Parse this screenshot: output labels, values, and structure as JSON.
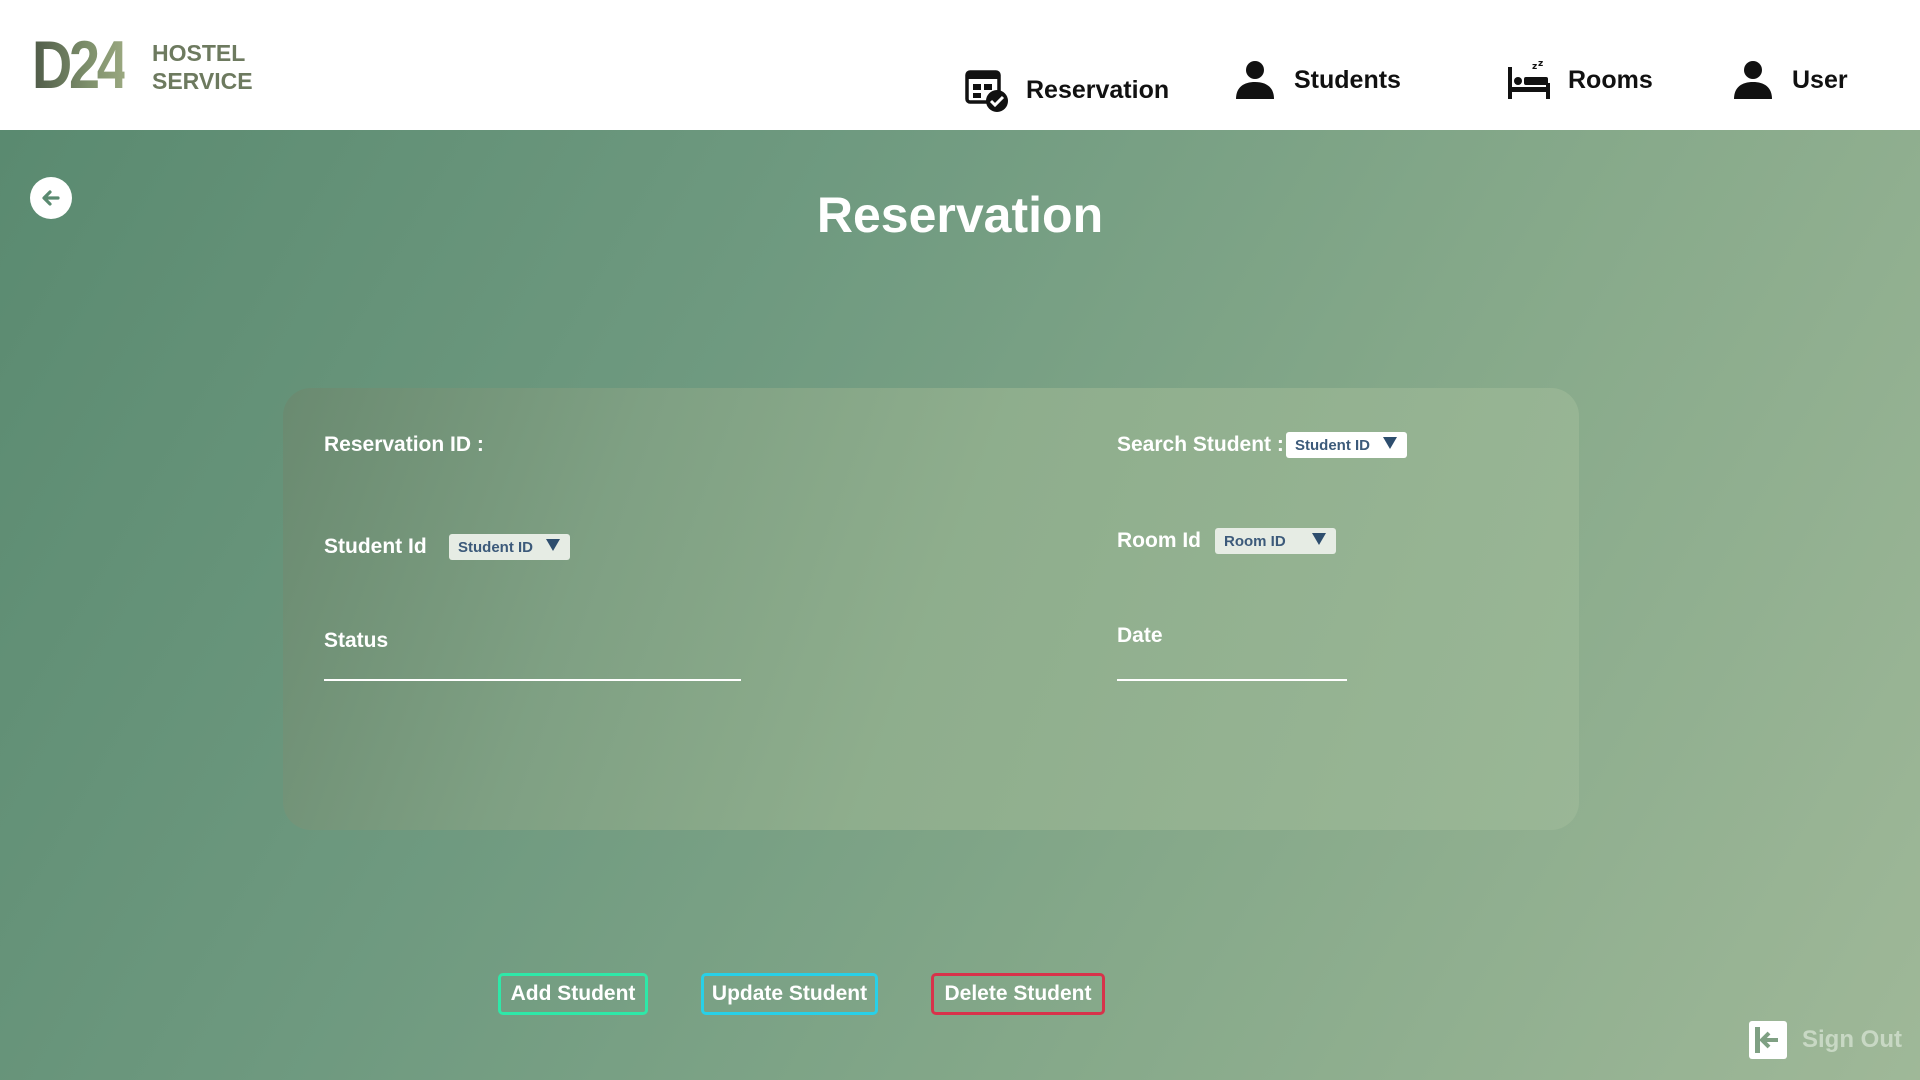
{
  "brand": {
    "mark": "D24",
    "line1": "HOSTEL",
    "line2": "SERVICE"
  },
  "nav": {
    "reservation": {
      "label": "Reservation",
      "icon": "calendar-check-icon"
    },
    "students": {
      "label": "Students",
      "icon": "person-icon"
    },
    "rooms": {
      "label": "Rooms",
      "icon": "bed-icon"
    },
    "user": {
      "label": "User",
      "icon": "person-icon"
    }
  },
  "page": {
    "title": "Reservation",
    "back_icon": "arrow-left-icon"
  },
  "form": {
    "reservation_id_label": "Reservation ID :",
    "search_student_label": "Search Student :",
    "search_student_select": "Student ID",
    "student_id_label": "Student Id",
    "student_id_select": "Student ID",
    "room_id_label": "Room Id",
    "room_id_select": "Room ID",
    "status_label": "Status",
    "date_label": "Date"
  },
  "actions": {
    "add": "Add Student",
    "update": "Update Student",
    "delete": "Delete Student"
  },
  "signout": {
    "label": "Sign Out",
    "icon": "sign-out-icon"
  },
  "colors": {
    "add_border": "#2ee8a8",
    "update_border": "#28d0e8",
    "delete_border": "#d8324a",
    "select_bg": "#ffffff",
    "select_bg_muted": "#e6ece4"
  }
}
